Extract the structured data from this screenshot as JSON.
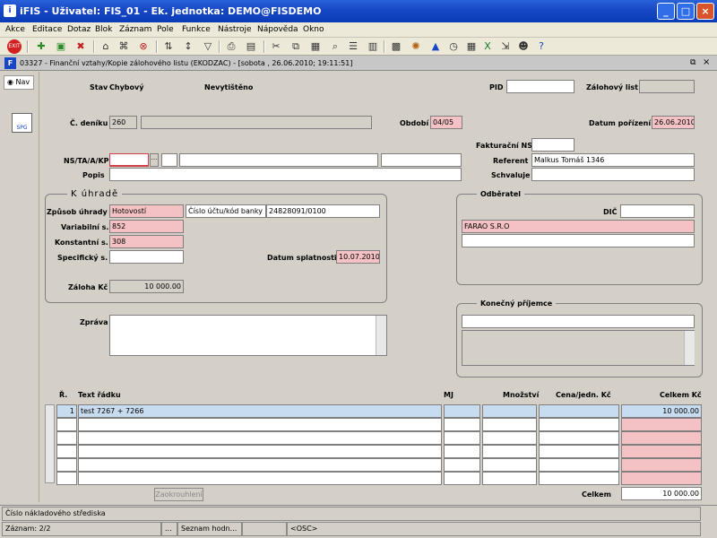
{
  "window": {
    "title": "iFIS - Uživatel: FIS_01 - Ek. jednotka: DEMO@FISDEMO",
    "app_icon": "ifis-logo-icon"
  },
  "menu": [
    "Akce",
    "Editace",
    "Dotaz",
    "Blok",
    "Záznam",
    "Pole",
    "Funkce",
    "Nástroje",
    "Nápověda",
    "Okno"
  ],
  "form": {
    "title": "03327 - Finanční vztahy/Kopie zálohového listu (EKODZAC) - [sobota , 26.06.2010; 19:11:51]"
  },
  "nav": {
    "label": "Nav",
    "spg_label": "SPG"
  },
  "header": {
    "stav_label": "Stav",
    "stav_value": "Chybový",
    "print_state": "Nevytištěno",
    "pid_label": "PID",
    "pid_value": "",
    "zal_list_label": "Zálohový list",
    "zal_list_value": "",
    "cdeniku_label": "Č. deníku",
    "cdeniku_value": "260",
    "cdeniku_desc": "",
    "obdobi_label": "Období",
    "obdobi_value": "04/05",
    "datum_por_label": "Datum pořízení",
    "datum_por_value": "26.06.2010",
    "fak_ns_label": "Fakturační NS",
    "fak_ns_value": "",
    "nstaakp_label": "NS/TA/A/KP",
    "nstaakp_btn": "...",
    "referent_label": "Referent",
    "referent_value": "Malkus Tomáš 1346",
    "popis_label": "Popis",
    "popis_value": "",
    "schvaluje_label": "Schvaluje",
    "schvaluje_value": ""
  },
  "uhrada": {
    "title": "K úhradě",
    "zpusob_label": "Způsob úhrady",
    "zpusob_value": "Hotovostí",
    "ucet_label": "Číslo účtu/kód banky",
    "ucet_value": "24828091/0100",
    "vs_label": "Variabilní s.",
    "vs_value": "852",
    "ks_label": "Konstantní s.",
    "ks_value": "308",
    "ss_label": "Specifický s.",
    "ss_value": "",
    "splatnost_label": "Datum splatnosti",
    "splatnost_value": "10.07.2010",
    "zaloha_label": "Záloha Kč",
    "zaloha_value": "10 000.00"
  },
  "odberatel": {
    "title": "Odběratel",
    "dic_label": "DIČ",
    "dic_value": "",
    "name": "FARAO S.R.O",
    "line2": ""
  },
  "prijemce": {
    "title": "Konečný příjemce",
    "line1": "",
    "line2": ""
  },
  "zprava": {
    "label": "Zpráva",
    "value": ""
  },
  "grid": {
    "headers": {
      "r": "Ř.",
      "text": "Text řádku",
      "mj": "MJ",
      "mnozstvi": "Množství",
      "cena": "Cena/jedn. Kč",
      "celkem": "Celkem Kč"
    },
    "rows": [
      {
        "r": "1",
        "text": "test 7267 + 7266",
        "mj": "",
        "mnozstvi": "",
        "cena": "",
        "celkem": "10 000.00"
      },
      {
        "r": "",
        "text": "",
        "mj": "",
        "mnozstvi": "",
        "cena": "",
        "celkem": ""
      },
      {
        "r": "",
        "text": "",
        "mj": "",
        "mnozstvi": "",
        "cena": "",
        "celkem": ""
      },
      {
        "r": "",
        "text": "",
        "mj": "",
        "mnozstvi": "",
        "cena": "",
        "celkem": ""
      },
      {
        "r": "",
        "text": "",
        "mj": "",
        "mnozstvi": "",
        "cena": "",
        "celkem": ""
      },
      {
        "r": "",
        "text": "",
        "mj": "",
        "mnozstvi": "",
        "cena": "",
        "celkem": ""
      }
    ],
    "round_btn": "Zaokrouhlení",
    "total_label": "Celkem",
    "total_value": "10 000.00"
  },
  "status": {
    "hint": "Číslo nákladového střediska",
    "record": "Záznam: 2/2",
    "dots": "...",
    "list": "Seznam hodn...",
    "osc": "<OSC>"
  }
}
